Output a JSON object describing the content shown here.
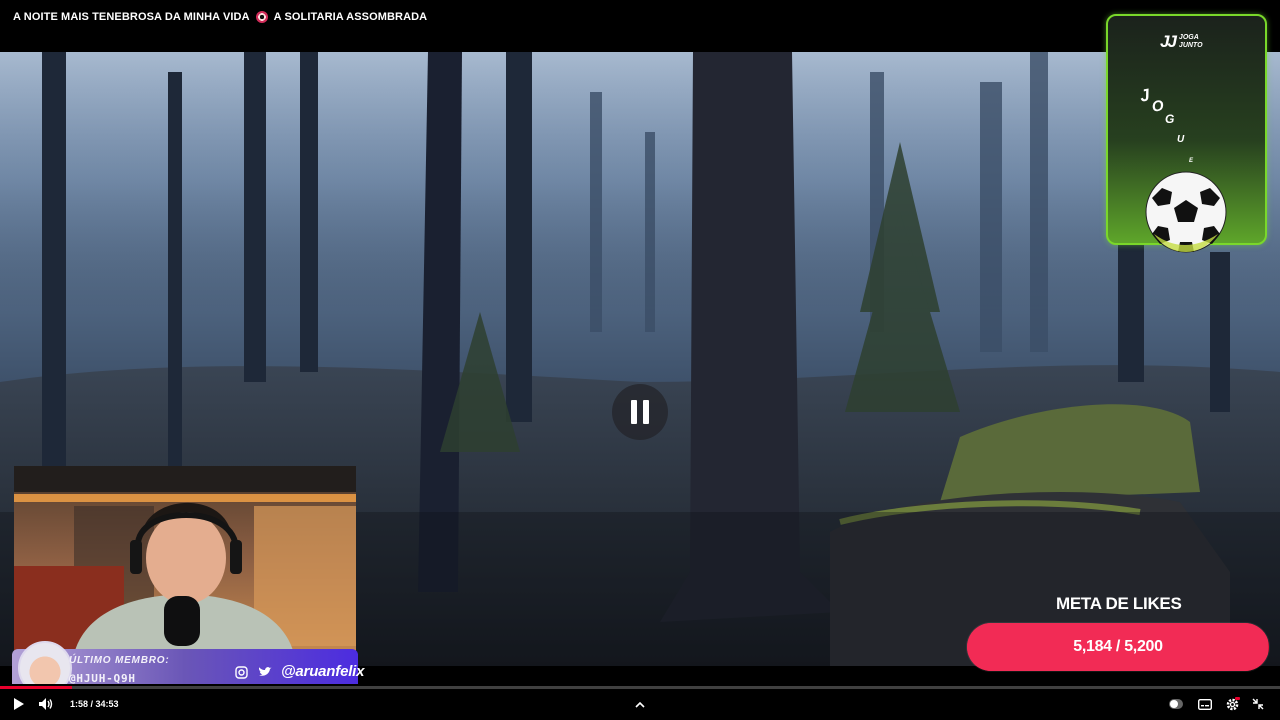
{
  "video": {
    "title_left": "A NOITE MAIS TENEBROSA DA MINHA VIDA",
    "title_right": "A SOLITARIA ASSOMBRADA"
  },
  "overlay_card": {
    "brand_mark": "JJ",
    "brand_line1": "JOGA",
    "brand_line2": "JUNTO",
    "animated_letters": [
      "J",
      "O",
      "G",
      "U",
      "E"
    ]
  },
  "member_banner": {
    "label": "ÚLTIMO MEMBRO:",
    "name": "@HJUH-Q9H",
    "handle": "@aruanfelix",
    "icons": [
      "instagram-icon",
      "twitter-icon"
    ]
  },
  "likes_goal": {
    "title": "META DE LIKES",
    "current_text": "5,184",
    "target_text": "5,200",
    "display": "5,184 / 5,200",
    "progress_fraction": 0.997,
    "accent": "#e8183f"
  },
  "player": {
    "time": "1:58 / 34:53",
    "progress_fraction": 0.0564,
    "played_color": "#e8002d"
  }
}
